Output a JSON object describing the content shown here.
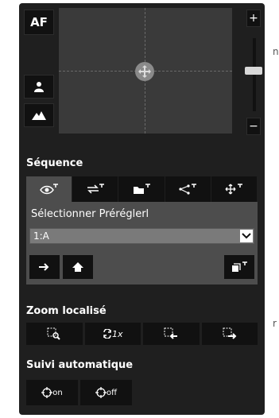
{
  "side_text": {
    "top": "n",
    "bottom": "r"
  },
  "camera": {
    "af_label": "AF",
    "zoom_plus": "+",
    "zoom_minus": "−",
    "zoom_level": 0.6
  },
  "sequence": {
    "title": "Séquence",
    "tabs": [
      "preset-view-icon",
      "swap-icon",
      "folder-icon",
      "share-icon",
      "move-icon"
    ],
    "active_tab": 0,
    "preset_label": "Sélectionner Préréglerl",
    "preset_value": "1:A"
  },
  "zoom_local": {
    "title": "Zoom localisé",
    "buttons": [
      "zoom-select-icon",
      "zoom-1x-icon",
      "zoom-in-icon",
      "zoom-out-icon"
    ],
    "onex_label": "1x"
  },
  "tracking": {
    "title": "Suivi automatique",
    "on_sub": "on",
    "off_sub": "off"
  }
}
